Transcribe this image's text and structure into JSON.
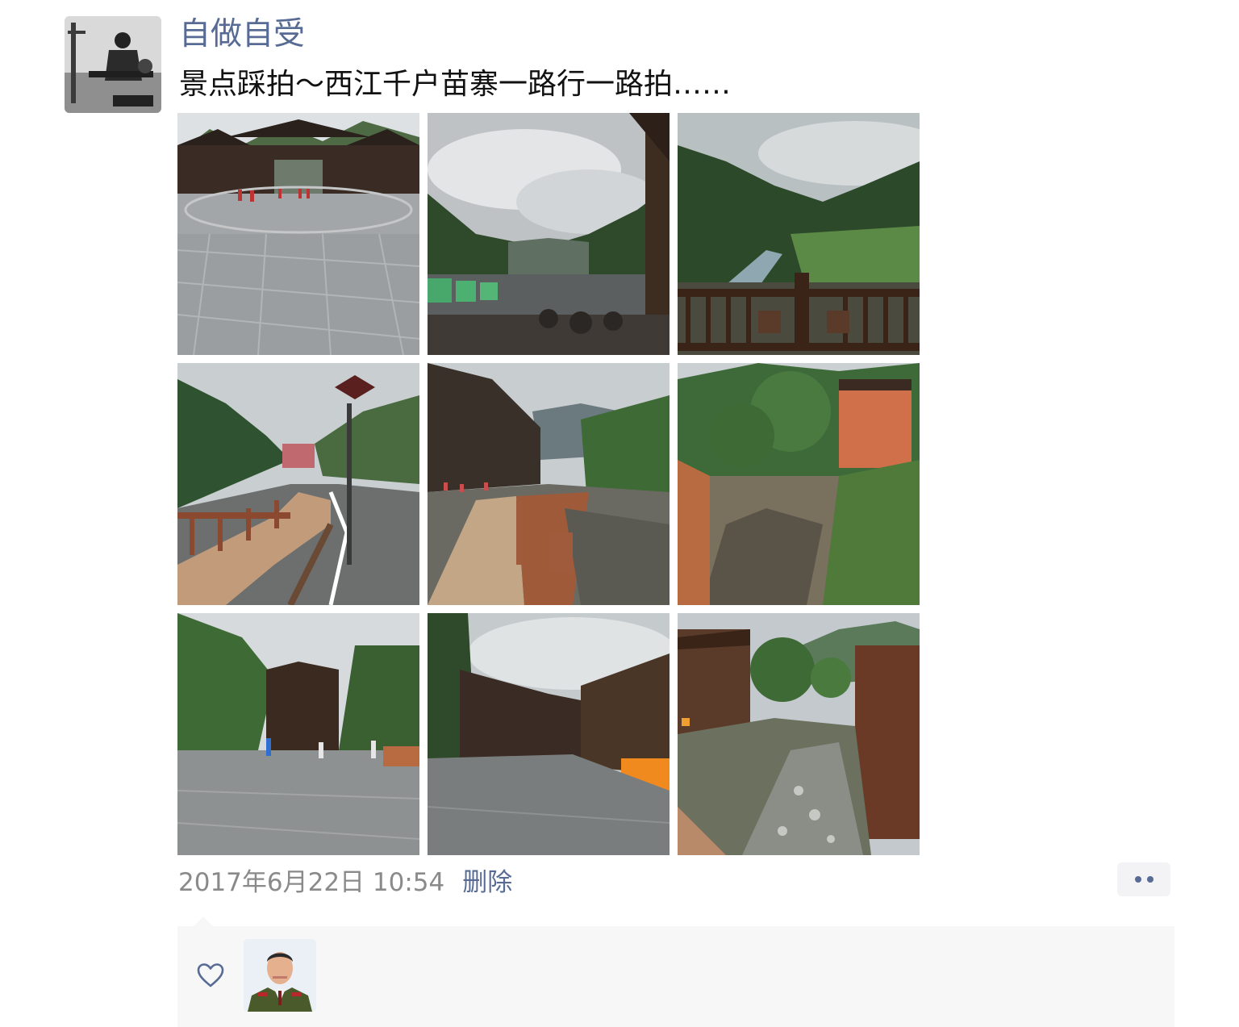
{
  "post": {
    "author": "自做自受",
    "text": "景点踩拍～西江千户苗寨一路行一路拍……",
    "timestamp": "2017年6月22日 10:54",
    "delete_label": "删除"
  },
  "photos": [
    {
      "scene": "gate-plaza"
    },
    {
      "scene": "cloudy-parking"
    },
    {
      "scene": "railing-valley"
    },
    {
      "scene": "road-boardwalk"
    },
    {
      "scene": "boardwalk-river"
    },
    {
      "scene": "river-building"
    },
    {
      "scene": "village-plaza"
    },
    {
      "scene": "village-street"
    },
    {
      "scene": "river-houses"
    }
  ],
  "colors": {
    "link": "#576b95",
    "timestamp": "#8a8a8a",
    "panel": "#f7f7f7"
  },
  "icons": [
    "like-heart-icon",
    "more-dots-icon"
  ]
}
